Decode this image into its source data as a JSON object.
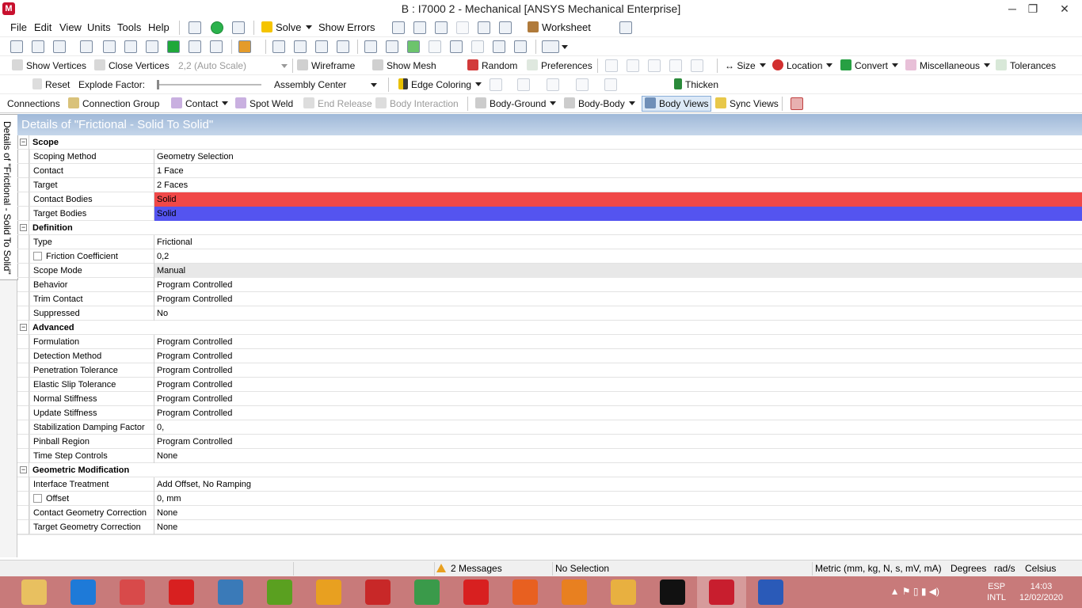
{
  "window": {
    "title": "B : I7000 2 - Mechanical [ANSYS Mechanical Enterprise]",
    "minimize": "─",
    "restore": "❐",
    "close": "✕",
    "logo": "M"
  },
  "menu": {
    "items": [
      "File",
      "Edit",
      "View",
      "Units",
      "Tools",
      "Help"
    ],
    "solve": "Solve",
    "show_errors": "Show Errors",
    "worksheet": "Worksheet"
  },
  "toolbar3": {
    "show_vertices": "Show Vertices",
    "close_vertices": "Close Vertices",
    "scale": "2,2 (Auto Scale)",
    "wireframe": "Wireframe",
    "show_mesh": "Show Mesh",
    "random": "Random",
    "preferences": "Preferences",
    "size": "Size",
    "location": "Location",
    "convert": "Convert",
    "miscellaneous": "Miscellaneous",
    "tolerances": "Tolerances"
  },
  "toolbar4": {
    "reset": "Reset",
    "explode_factor": "Explode Factor:",
    "assembly_center": "Assembly Center",
    "edge_coloring": "Edge Coloring",
    "thicken": "Thicken"
  },
  "toolbar5": {
    "connections": "Connections",
    "connection_group": "Connection Group",
    "contact": "Contact",
    "spot_weld": "Spot Weld",
    "end_release": "End Release",
    "body_interaction": "Body Interaction",
    "body_ground": "Body-Ground",
    "body_body": "Body-Body",
    "body_views": "Body Views",
    "sync_views": "Sync Views"
  },
  "side_tab": "Details of \"Frictional - Solid To Solid\"",
  "details": {
    "header": "Details of \"Frictional - Solid To Solid\"",
    "sections": [
      {
        "title": "Scope",
        "rows": [
          {
            "k": "Scoping Method",
            "v": "Geometry Selection"
          },
          {
            "k": "Contact",
            "v": "1 Face"
          },
          {
            "k": "Target",
            "v": "2 Faces"
          },
          {
            "k": "Contact Bodies",
            "v": "Solid"
          },
          {
            "k": "Target Bodies",
            "v": "Solid"
          }
        ]
      },
      {
        "title": "Definition",
        "rows": [
          {
            "k": "Type",
            "v": "Frictional"
          },
          {
            "k": "Friction Coefficient",
            "v": "0,2"
          },
          {
            "k": "Scope Mode",
            "v": "Manual"
          },
          {
            "k": "Behavior",
            "v": "Program Controlled"
          },
          {
            "k": "Trim Contact",
            "v": "Program Controlled"
          },
          {
            "k": "Suppressed",
            "v": "No"
          }
        ]
      },
      {
        "title": "Advanced",
        "rows": [
          {
            "k": "Formulation",
            "v": "Program Controlled"
          },
          {
            "k": "Detection Method",
            "v": "Program Controlled"
          },
          {
            "k": "Penetration Tolerance",
            "v": "Program Controlled"
          },
          {
            "k": "Elastic Slip Tolerance",
            "v": "Program Controlled"
          },
          {
            "k": "Normal Stiffness",
            "v": "Program Controlled"
          },
          {
            "k": "Update Stiffness",
            "v": "Program Controlled"
          },
          {
            "k": "Stabilization Damping Factor",
            "v": "0,"
          },
          {
            "k": "Pinball Region",
            "v": "Program Controlled"
          },
          {
            "k": "Time Step Controls",
            "v": "None"
          }
        ]
      },
      {
        "title": "Geometric Modification",
        "rows": [
          {
            "k": "Interface Treatment",
            "v": "Add Offset, No Ramping"
          },
          {
            "k": "Offset",
            "v": "0, mm"
          },
          {
            "k": "Contact Geometry Correction",
            "v": "None"
          },
          {
            "k": "Target Geometry Correction",
            "v": "None"
          }
        ]
      }
    ],
    "colors": {
      "contact_bodies": "#f04848",
      "target_bodies": "#5454f0",
      "scope_mode": "#e8e8e8"
    }
  },
  "status": {
    "messages": "2 Messages",
    "selection": "No Selection",
    "units": "Metric (mm, kg, N, s, mV, mA)",
    "angle": "Degrees",
    "rot": "rad/s",
    "temp": "Celsius"
  },
  "taskbar": {
    "lang1": "ESP",
    "lang2": "INTL",
    "time": "14:03",
    "date": "12/02/2020",
    "apps": [
      "explorer-icon",
      "ie-icon",
      "winrar-icon",
      "sap-icon",
      "sketch-icon",
      "word-green-icon",
      "gauge-icon",
      "text-icon",
      "chrome-icon",
      "opera-icon",
      "firefox-icon",
      "brave-icon",
      "van-icon",
      "autocad-icon",
      "ansys-icon",
      "word-icon"
    ]
  }
}
